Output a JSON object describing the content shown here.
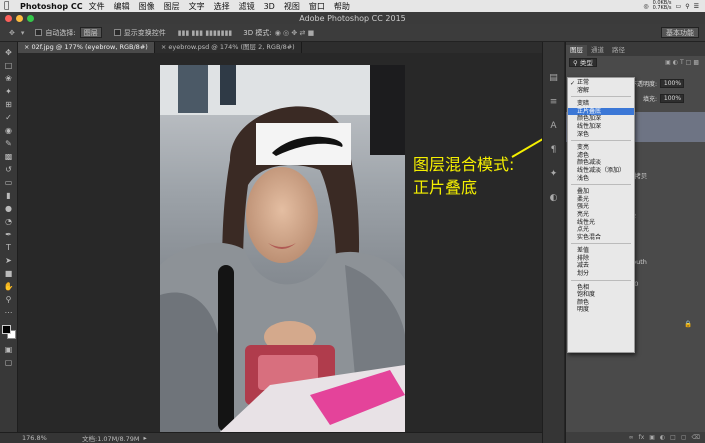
{
  "menubar": {
    "app_name": "Photoshop CC",
    "items": [
      "文件",
      "编辑",
      "图像",
      "图层",
      "文字",
      "选择",
      "滤镜",
      "3D",
      "视图",
      "窗口",
      "帮助"
    ],
    "net_up": "0.0KB/s",
    "net_down": "0.7KB/s"
  },
  "window": {
    "title": "Adobe Photoshop CC 2015"
  },
  "options_bar": {
    "auto_select_label": "自动选择:",
    "auto_select_value": "图层",
    "transform_label": "显示变换控件",
    "mode_3d": "3D 模式:",
    "workspace": "基本功能"
  },
  "tabs": [
    {
      "label": "02f.jpg @ 177% (eyebrow, RGB/8#)",
      "active": true
    },
    {
      "label": "eyebrow.psd @ 174% (图层 2, RGB/8#)",
      "active": false
    }
  ],
  "annotation": {
    "line1": "图层混合模式:",
    "line2": "正片叠底"
  },
  "status": {
    "zoom": "176.8%",
    "doc": "文档:1.07M/8.79M"
  },
  "layers_panel": {
    "tabs": [
      "图层",
      "通道",
      "路径"
    ],
    "kind_filter": "类型",
    "opacity_label": "不透明度:",
    "opacity_value": "100%",
    "fill_label": "填充:",
    "fill_value": "100%",
    "layer_fragments": [
      "p 拷贝",
      "p",
      "p2",
      "nouth",
      "1.0"
    ]
  },
  "blend_menu": {
    "current": "正常",
    "selected": "正片叠底",
    "groups": [
      [
        "正常",
        "溶解"
      ],
      [
        "变暗",
        "正片叠底",
        "颜色加深",
        "线性加深",
        "深色"
      ],
      [
        "变亮",
        "滤色",
        "颜色减淡",
        "线性减淡（添加）",
        "浅色"
      ],
      [
        "叠加",
        "柔光",
        "强光",
        "亮光",
        "线性光",
        "点光",
        "实色混合"
      ],
      [
        "差值",
        "排除",
        "减去",
        "划分"
      ],
      [
        "色相",
        "饱和度",
        "颜色",
        "明度"
      ]
    ]
  }
}
